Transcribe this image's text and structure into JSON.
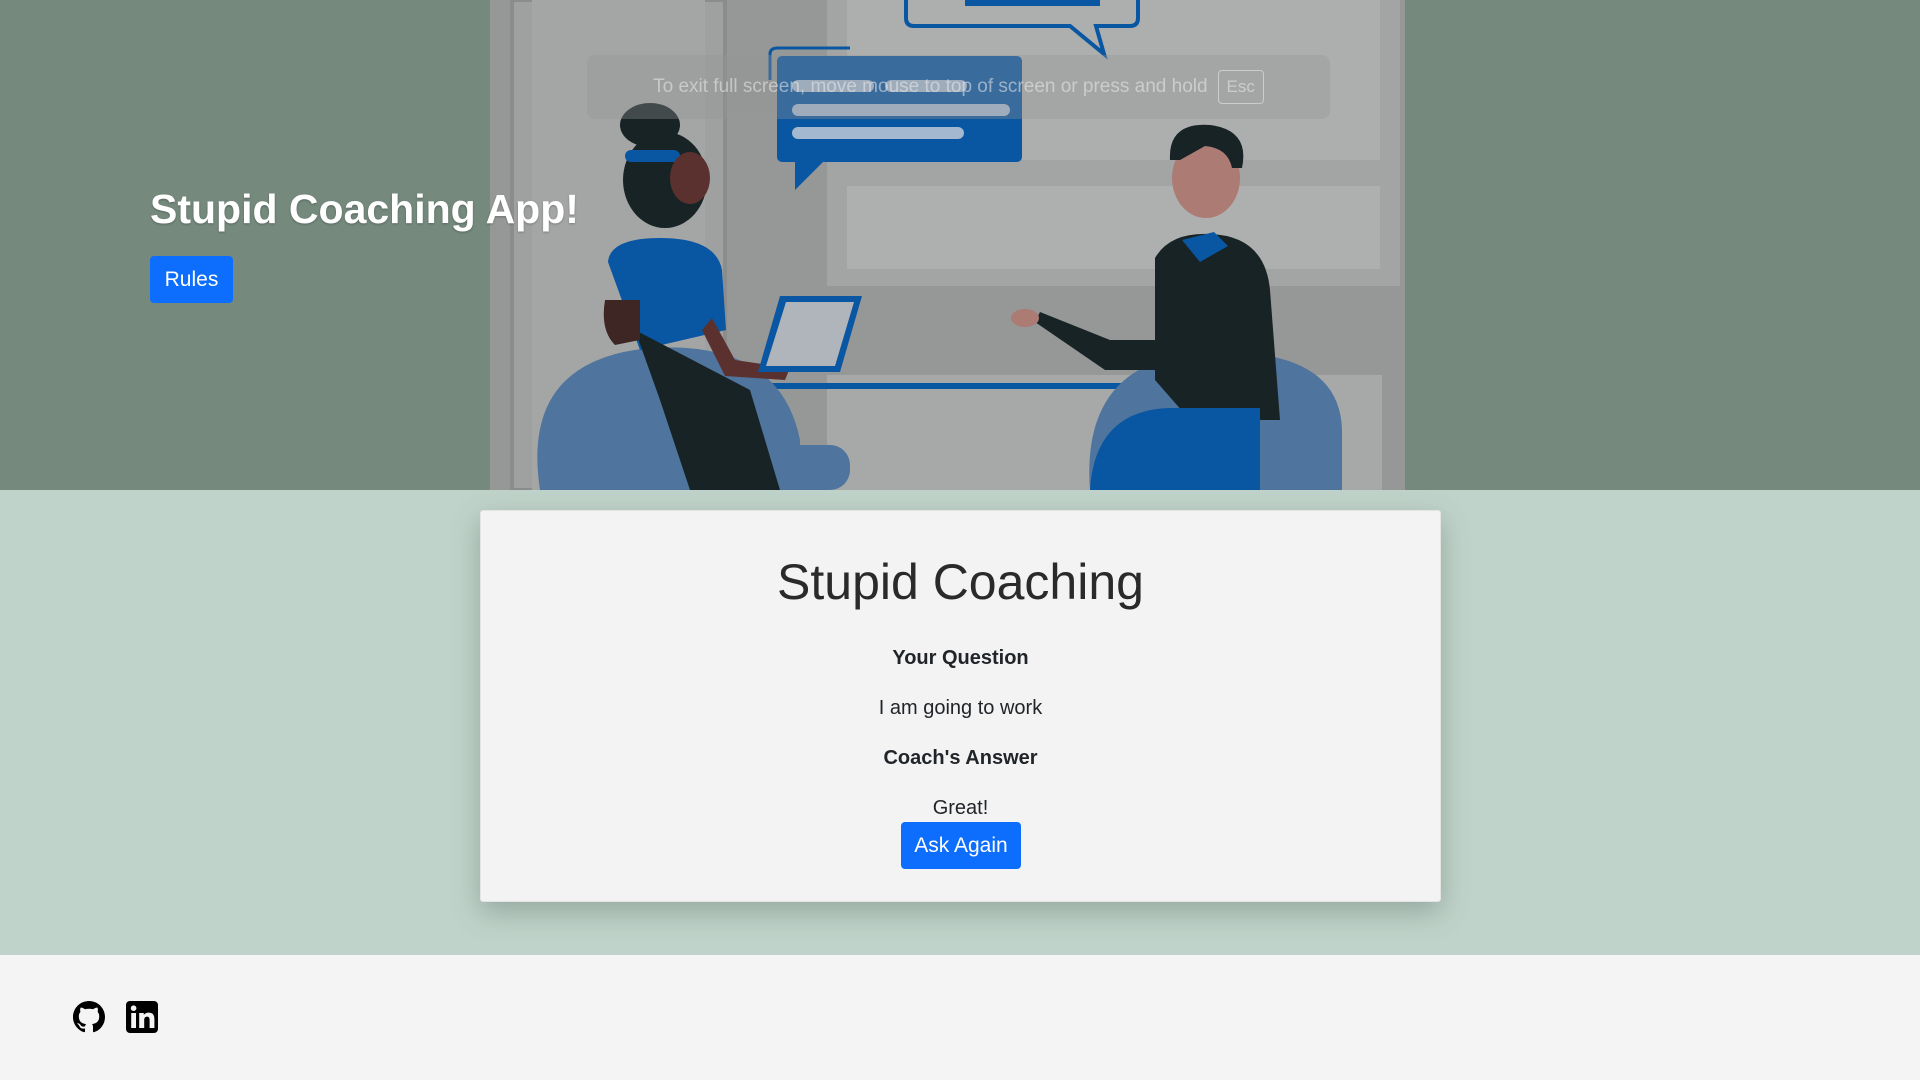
{
  "hero": {
    "title": "Stupid Coaching App!",
    "rules_button": "Rules",
    "illustration": "two-people-coaching-conversation-illustration",
    "fullscreen_notice": {
      "text": "To exit full screen, move mouse to top of screen or press and hold",
      "key": "Esc"
    }
  },
  "card": {
    "title": "Stupid Coaching",
    "question_label": "Your Question",
    "question_text": "I am going to work",
    "answer_label": "Coach's Answer",
    "answer_text": "Great!",
    "ask_again_button": "Ask Again"
  },
  "footer": {
    "icons": [
      "github-icon",
      "linkedin-icon"
    ]
  },
  "colors": {
    "hero_bg": "#75897d",
    "main_bg": "#c0d3ca",
    "card_bg": "#f3f3f3",
    "button_primary": "#0d6efd",
    "illustration_blue": "#0052a5"
  }
}
